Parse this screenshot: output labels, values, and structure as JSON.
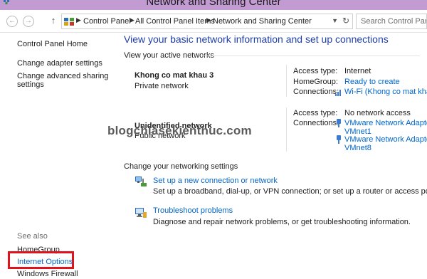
{
  "window": {
    "title": "Network and Sharing Center"
  },
  "address_bar": {
    "breadcrumbs": [
      "Control Panel",
      "All Control Panel Items",
      "Network and Sharing Center"
    ],
    "search_placeholder": "Search Control Panel"
  },
  "sidebar": {
    "home": "Control Panel Home",
    "links": [
      "Change adapter settings",
      "Change advanced sharing settings"
    ],
    "see_also_label": "See also",
    "see_also": [
      "HomeGroup",
      "Internet Options",
      "Windows Firewall"
    ]
  },
  "main": {
    "heading": "View your basic network information and set up connections",
    "active_networks_label": "View your active networks",
    "networks": [
      {
        "name": "Khong co mat khau  3",
        "type": "Private network",
        "access_type_label": "Access type:",
        "access_type": "Internet",
        "homegroup_label": "HomeGroup:",
        "homegroup": "Ready to create",
        "connections_label": "Connections:",
        "connections": [
          "Wi-Fi (Khong co mat khau)"
        ]
      },
      {
        "name": "Unidentified network",
        "type": "Public network",
        "access_type_label": "Access type:",
        "access_type": "No network access",
        "connections_label": "Connections:",
        "connections": [
          "VMware Network Adapter",
          "VMnet1",
          "VMware Network Adapter",
          "VMnet8"
        ]
      }
    ],
    "change_settings_label": "Change your networking settings",
    "tasks": [
      {
        "title": "Set up a new connection or network",
        "description": "Set up a broadband, dial-up, or VPN connection; or set up a router or access point.",
        "icon": "network-setup-icon"
      },
      {
        "title": "Troubleshoot problems",
        "description": "Diagnose and repair network problems, or get troubleshooting information.",
        "icon": "troubleshoot-icon"
      }
    ]
  },
  "watermark": "blogchiasekienthuc.com",
  "colors": {
    "titlebar": "#c39bd3",
    "link": "#0066cc",
    "heading": "#1f3fa8",
    "highlight": "#e0121b"
  }
}
